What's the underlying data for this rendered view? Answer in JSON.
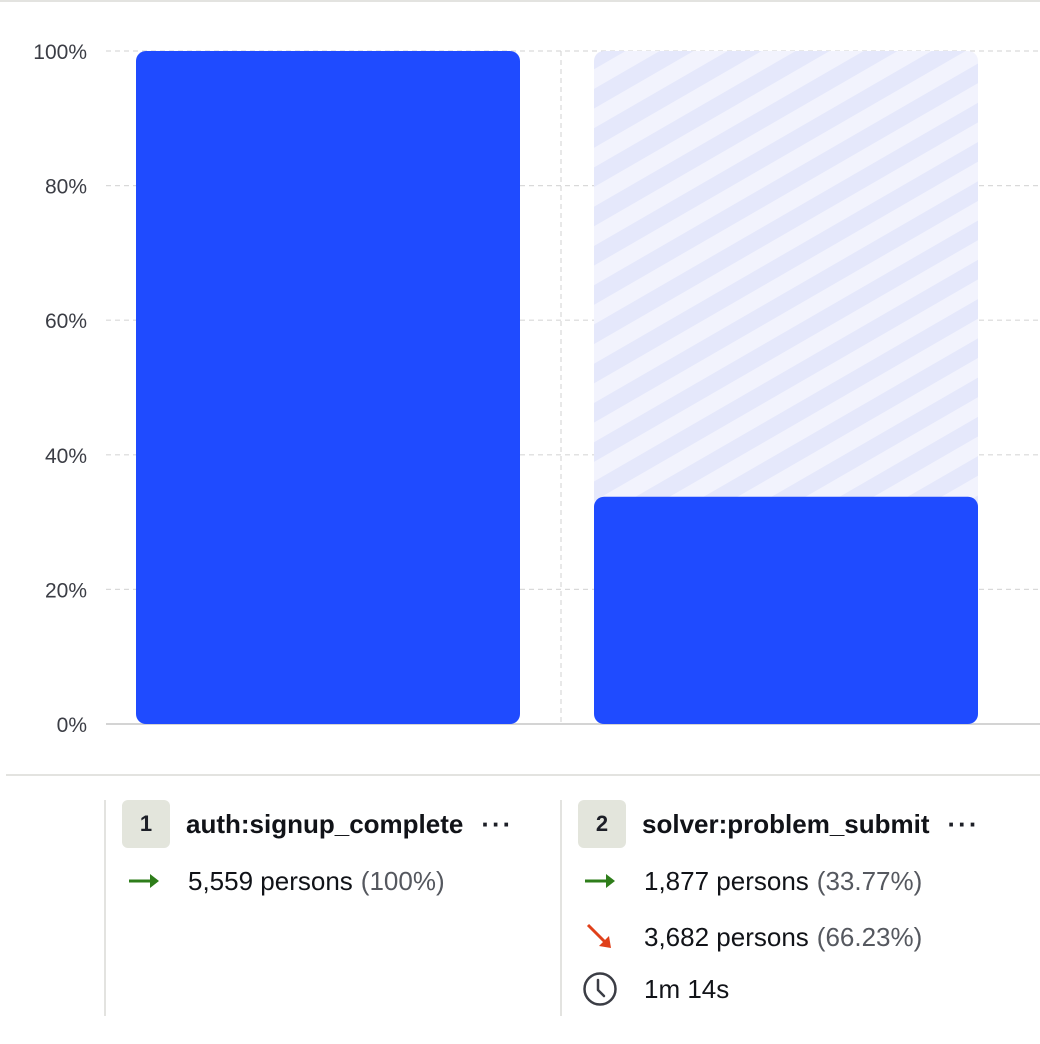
{
  "chart_data": {
    "type": "bar",
    "categories": [
      "auth:signup_complete",
      "solver:problem_submit"
    ],
    "values": [
      100,
      33.77
    ],
    "ylim": [
      0,
      100
    ],
    "yticks": [
      "0%",
      "20%",
      "40%",
      "60%",
      "80%",
      "100%"
    ],
    "ytick_values": [
      0,
      20,
      40,
      60,
      80,
      100
    ],
    "grid": true,
    "colors": {
      "bar": "#1f4bff",
      "dropoff_stripe_a": "#e5e8fb",
      "dropoff_stripe_b": "#f2f3fd",
      "grid": "#d9d9d9"
    }
  },
  "steps": [
    {
      "number": "1",
      "name": "auth:signup_complete",
      "more_label": "···",
      "converted": {
        "count_label": "5,559 persons",
        "pct_label": "(100%)"
      }
    },
    {
      "number": "2",
      "name": "solver:problem_submit",
      "more_label": "···",
      "converted": {
        "count_label": "1,877 persons",
        "pct_label": "(33.77%)"
      },
      "dropped": {
        "count_label": "3,682 persons",
        "pct_label": "(66.23%)"
      },
      "time_label": "1m 14s"
    }
  ],
  "icons": {
    "converted": "arrow-right-icon",
    "dropped": "arrow-down-right-icon",
    "time": "clock-icon"
  }
}
